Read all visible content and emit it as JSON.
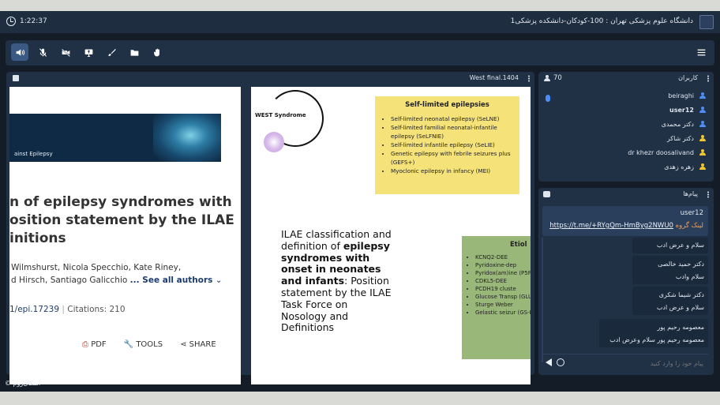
{
  "header": {
    "time": "1:22:37",
    "title": "دانشگاه علوم پزشکی تهران : 100-کودکان-دانشکده پزشکی1"
  },
  "toolbar": {
    "icons": [
      "speaker-icon",
      "mic-muted-icon",
      "camera-off-icon",
      "screen-share-icon",
      "brush-icon",
      "folder-icon",
      "raise-hand-icon"
    ],
    "menu_icon": "hamburger-icon"
  },
  "presentation": {
    "filename": "West final.1404",
    "left_slide": {
      "banner_text": "ainst Epilepsy",
      "heading_lines": [
        "n of epilepsy syndromes with",
        "osition statement by the ILAE",
        "initions"
      ],
      "authors_line1": "Wilmshurst, Nicola Specchio, Kate Riney,",
      "authors_line2": "d Hirsch, Santiago Galicchio",
      "see_all": "... See all authors",
      "doi": "1/epi.17239",
      "citations": "Citations: 210",
      "actions": {
        "pdf": "PDF",
        "tools": "TOOLS",
        "share": "SHARE"
      }
    },
    "right_slide": {
      "circle_label": "WEST Syndrome",
      "yellow_title": "Self-limited epilepsies",
      "yellow_items": [
        "Self-limited neonatal epilepsy (SeLNE)",
        "Self-limited familial neonatal-infantile epilepsy (SeLFNIE)",
        "Self-limited infantile epilepsy (SeLIE)",
        "Genetic epilepsy with febrile seizures plus (GEFS+)",
        "Myoclonic epilepsy in infancy (MEI)"
      ],
      "main_text_before": "ILAE classification and definition of ",
      "main_text_bold": "epilepsy syndromes with onset in neonates and infants",
      "main_text_after": ": Position statement by the ILAE Task Force on Nosology and Definitions",
      "green_title": "Etiol",
      "green_items": [
        "KCNQ2-DEE",
        "Pyridoxine-dep",
        "Pyridox(am)ine (P5PD-DEE)",
        "CDKL5-DEE",
        "PCDH19 cluste",
        "Glucose Transp (GLUT1DS)",
        "Sturge Weber",
        "Gelastic seizur (GS-HH)"
      ]
    }
  },
  "users": {
    "count": "70",
    "label": "کاربران",
    "list": [
      {
        "name": "beiraghi",
        "color": "#4d8df5",
        "bold": false
      },
      {
        "name": "user12",
        "color": "#4d8df5",
        "bold": true
      },
      {
        "name": "دکتر محمدی",
        "color": "#4d8df5",
        "bold": false
      },
      {
        "name": "دکتر شاکر",
        "color": "#f2c62f",
        "bold": false
      },
      {
        "name": "dr khezr doosalivand",
        "color": "#f2c62f",
        "bold": false
      },
      {
        "name": "زهره زهدی",
        "color": "#f2c62f",
        "bold": false
      }
    ]
  },
  "chat": {
    "label": "پیام‌ها",
    "pinned_user": "user12",
    "pinned_link": "https://t.me/+RYgQm-HmByg2NWU0",
    "pinned_link_label": "لینک گروه",
    "messages": [
      {
        "name": "",
        "text": "سلام و عرض ادب"
      },
      {
        "name": "دکتر حمید خالصی",
        "text": "سلام وادب"
      },
      {
        "name": "دکتر شیما شکری",
        "text": "سلام و عرض ادب"
      },
      {
        "name": "معصومه رحیم پور",
        "text": "معصومه رحیم پور سلام وعرض ادب"
      }
    ],
    "input_placeholder": "پیام خود را وارد کنید"
  },
  "footer": {
    "brand": "© اسکای‌روم"
  }
}
